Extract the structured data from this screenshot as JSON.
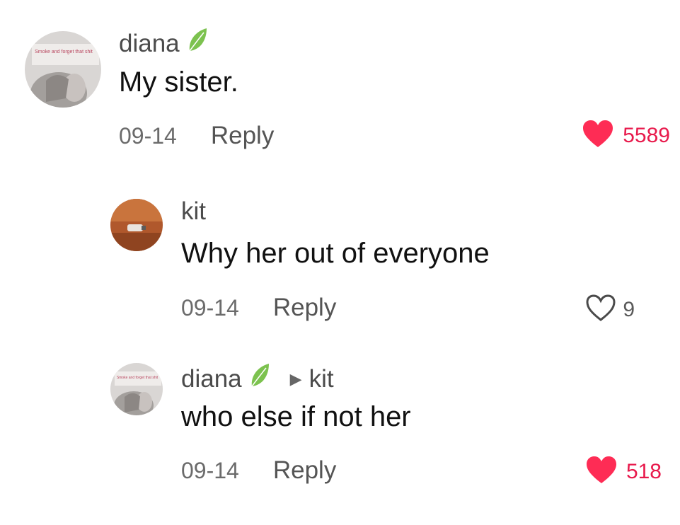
{
  "comments": [
    {
      "username": "diana",
      "text": "My sister.",
      "date": "09-14",
      "reply_label": "Reply",
      "likes": "5589",
      "liked": true,
      "avatar_caption": "Smoke and forget that shit"
    },
    {
      "username": "kit",
      "text": "Why her out of everyone",
      "date": "09-14",
      "reply_label": "Reply",
      "likes": "9",
      "liked": false
    },
    {
      "username": "diana",
      "reply_to": "kit",
      "text": "who else if not her",
      "date": "09-14",
      "reply_label": "Reply",
      "likes": "518",
      "liked": true,
      "avatar_caption": "Smoke and forget that shit"
    }
  ],
  "colors": {
    "liked": "#fe2c55",
    "text": "#111111",
    "muted": "#6b6b6b"
  },
  "icons": [
    "leaf-badge-icon",
    "heart-icon",
    "heart-outline-icon",
    "reply-arrow-icon"
  ]
}
